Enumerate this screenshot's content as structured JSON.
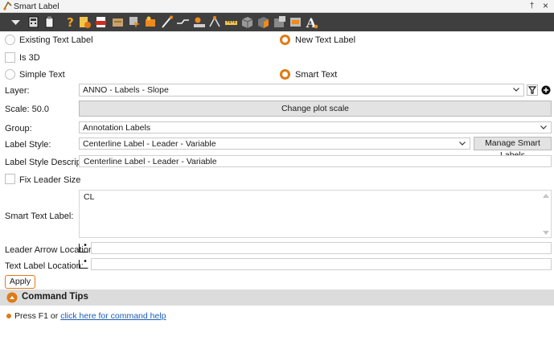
{
  "window": {
    "title": "Smart Label",
    "pin_glyph": "†",
    "close_glyph": "×"
  },
  "options": {
    "existing_text_label": "Existing Text Label",
    "new_text_label": "New Text Label",
    "is_3d": "Is 3D",
    "simple_text": "Simple Text",
    "smart_text": "Smart Text",
    "selected_source": "new_text_label",
    "selected_mode": "smart_text",
    "is_3d_checked": false
  },
  "layer": {
    "label": "Layer:",
    "value": "ANNO - Labels - Slope"
  },
  "scale": {
    "label": "Scale: 50.0",
    "button": "Change plot scale"
  },
  "group": {
    "label": "Group:",
    "value": "Annotation Labels"
  },
  "label_style": {
    "label": "Label Style:",
    "value": "Centerline Label - Leader - Variable",
    "manage_button": "Manage Smart Labels"
  },
  "label_style_description": {
    "label": "Label Style Description:",
    "value": "Centerline Label - Leader - Variable"
  },
  "fix_leader_size": {
    "label": "Fix Leader Size",
    "checked": false
  },
  "smart_text_label": {
    "label": "Smart Text Label:",
    "value": "CL"
  },
  "leader_arrow_location": {
    "label": "Leader Arrow Location:",
    "value": ""
  },
  "text_label_location": {
    "label": "Text Label Location:",
    "value": ""
  },
  "apply_button": "Apply",
  "command_tips": {
    "title": "Command Tips",
    "prefix": "Press F1 or ",
    "link": "click here for command help"
  },
  "colors": {
    "accent": "#e07a14",
    "toolbar": "#3f3f3f",
    "link": "#1a5db5"
  },
  "toolbar_icons": [
    "dropdown-arrow-icon",
    "calculator-icon",
    "clipboard-icon",
    "help-icon",
    "document-settings-icon",
    "pdf-icon",
    "export-icon",
    "select-icon",
    "label-tool-icon",
    "pen-icon",
    "leader-icon",
    "road-icon",
    "survey-icon",
    "measure-icon",
    "box-icon",
    "3d-box-icon",
    "block-icon",
    "layers-icon",
    "text-icon"
  ]
}
